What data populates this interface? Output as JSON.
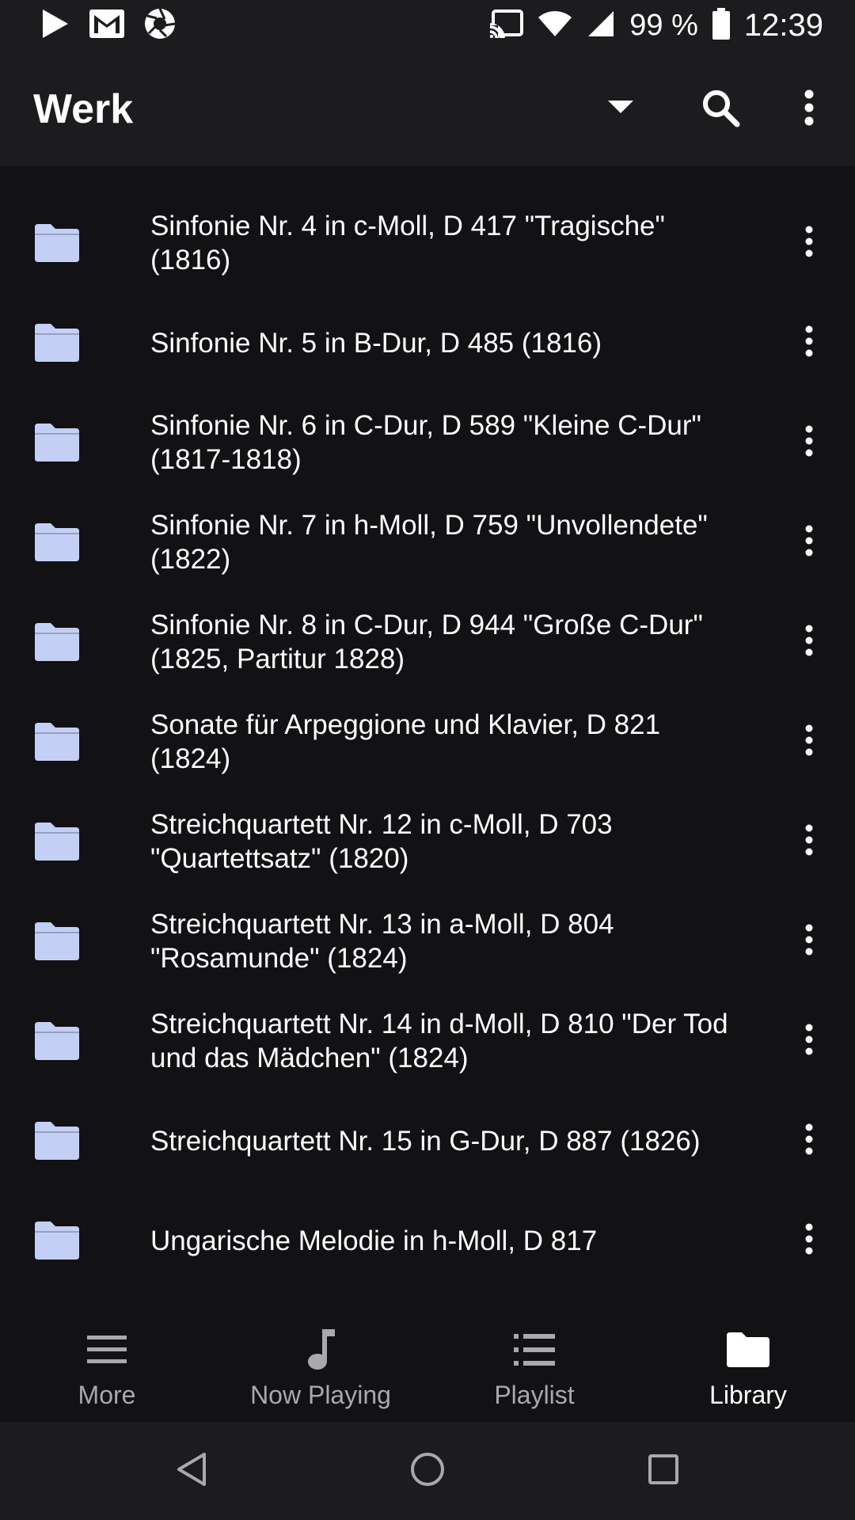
{
  "status_bar": {
    "battery": "99 %",
    "time": "12:39",
    "left_icons": [
      "play-store-icon",
      "gmail-icon",
      "camera-aperture-icon"
    ],
    "right_icons": [
      "cast-icon",
      "wifi-icon",
      "signal-icon",
      "battery-icon"
    ]
  },
  "app_bar": {
    "title": "Werk",
    "actions": [
      "dropdown-arrow-icon",
      "search-icon",
      "more-vert-icon"
    ]
  },
  "colors": {
    "background": "#121214",
    "bar": "#1c1c1e",
    "folder": "#c3cff5",
    "text": "#ffffff",
    "inactive": "#a9a9ad"
  },
  "items": [
    {
      "label": "Sinfonie Nr. 4 in c-Moll, D 417 \"Tragische\" (1816)"
    },
    {
      "label": "Sinfonie Nr. 5 in B-Dur, D 485 (1816)"
    },
    {
      "label": "Sinfonie Nr. 6 in C-Dur, D 589 \"Kleine C-Dur\" (1817-1818)"
    },
    {
      "label": "Sinfonie Nr. 7 in h-Moll, D 759 \"Unvollendete\" (1822)"
    },
    {
      "label": "Sinfonie Nr. 8 in C-Dur, D 944 \"Große C-Dur\" (1825, Partitur 1828)"
    },
    {
      "label": "Sonate für Arpeggione und Klavier, D 821 (1824)"
    },
    {
      "label": "Streichquartett Nr. 12 in c-Moll, D 703 \"Quartettsatz\" (1820)"
    },
    {
      "label": "Streichquartett Nr. 13 in a-Moll, D 804 \"Rosamunde\" (1824)"
    },
    {
      "label": "Streichquartett Nr. 14 in d-Moll, D 810 \"Der Tod und das Mädchen\" (1824)"
    },
    {
      "label": "Streichquartett Nr. 15 in G-Dur, D 887 (1826)"
    },
    {
      "label": "Ungarische Melodie in h-Moll, D 817"
    }
  ],
  "bottom_nav": {
    "more": "More",
    "now_playing": "Now Playing",
    "playlist": "Playlist",
    "library": "Library",
    "active": "library"
  },
  "system_nav": [
    "back-icon",
    "home-icon",
    "recents-icon"
  ]
}
